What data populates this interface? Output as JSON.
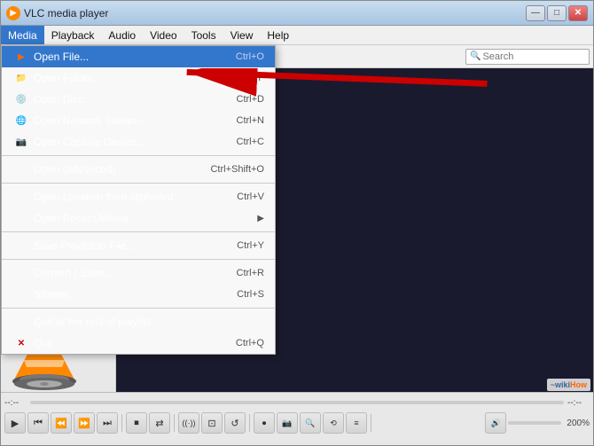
{
  "window": {
    "title": "VLC media player",
    "icon": "▶"
  },
  "titlebar": {
    "minimize": "—",
    "maximize": "□",
    "close": "✕"
  },
  "menubar": {
    "items": [
      {
        "id": "media",
        "label": "Media",
        "active": true
      },
      {
        "id": "playback",
        "label": "Playback"
      },
      {
        "id": "audio",
        "label": "Audio"
      },
      {
        "id": "video",
        "label": "Video"
      },
      {
        "id": "tools",
        "label": "Tools"
      },
      {
        "id": "view",
        "label": "View"
      },
      {
        "id": "help",
        "label": "Help"
      }
    ]
  },
  "dropdown": {
    "items": [
      {
        "id": "open-file",
        "label": "Open File...",
        "shortcut": "Ctrl+O",
        "highlighted": true,
        "icon": "▶",
        "hasIcon": true
      },
      {
        "id": "open-folder",
        "label": "Open Folder...",
        "shortcut": "Ctrl+F",
        "hasIcon": true,
        "icon": "📁"
      },
      {
        "id": "open-disc",
        "label": "Open Disc...",
        "shortcut": "Ctrl+D",
        "hasIcon": true,
        "icon": "💿"
      },
      {
        "id": "open-network",
        "label": "Open Network Stream...",
        "shortcut": "Ctrl+N",
        "hasIcon": true,
        "icon": "🌐"
      },
      {
        "id": "open-capture",
        "label": "Open Capture Device...",
        "shortcut": "Ctrl+C",
        "hasIcon": true,
        "icon": "📷"
      },
      {
        "separator": true
      },
      {
        "id": "open-advanced",
        "label": "Open (advanced)...",
        "shortcut": "Ctrl+Shift+O"
      },
      {
        "separator": true
      },
      {
        "id": "open-location",
        "label": "Open Location from clipboard",
        "shortcut": "Ctrl+V"
      },
      {
        "id": "open-recent",
        "label": "Open Recent Media",
        "arrow": true
      },
      {
        "separator": true
      },
      {
        "id": "save-playlist",
        "label": "Save Playlist to File...",
        "shortcut": "Ctrl+Y"
      },
      {
        "separator": true
      },
      {
        "id": "convert-save",
        "label": "Convert / Save...",
        "shortcut": "Ctrl+R"
      },
      {
        "id": "stream",
        "label": "Stream...",
        "shortcut": "Ctrl+S"
      },
      {
        "separator": true
      },
      {
        "id": "quit-end",
        "label": "Quit at the end of playlist"
      },
      {
        "id": "quit",
        "label": "Quit",
        "shortcut": "Ctrl+Q",
        "hasRedX": true
      }
    ]
  },
  "search": {
    "placeholder": "Search"
  },
  "controls": {
    "time_left": "--:--",
    "time_right": "--:--",
    "zoom": "200%",
    "play": "▶",
    "prev": "⏮",
    "prev_step": "⏪",
    "next_step": "⏩",
    "next": "⏭",
    "stop": "⏹",
    "shuffle": "⇄",
    "repeat": "↺",
    "frame": "⊡",
    "loop": "⟲",
    "teletext": "T",
    "record": "⏺",
    "snapshot": "📷",
    "zoom_btn": "🔍",
    "sync": "⟲",
    "eq": "≡",
    "volume": "🔊"
  }
}
